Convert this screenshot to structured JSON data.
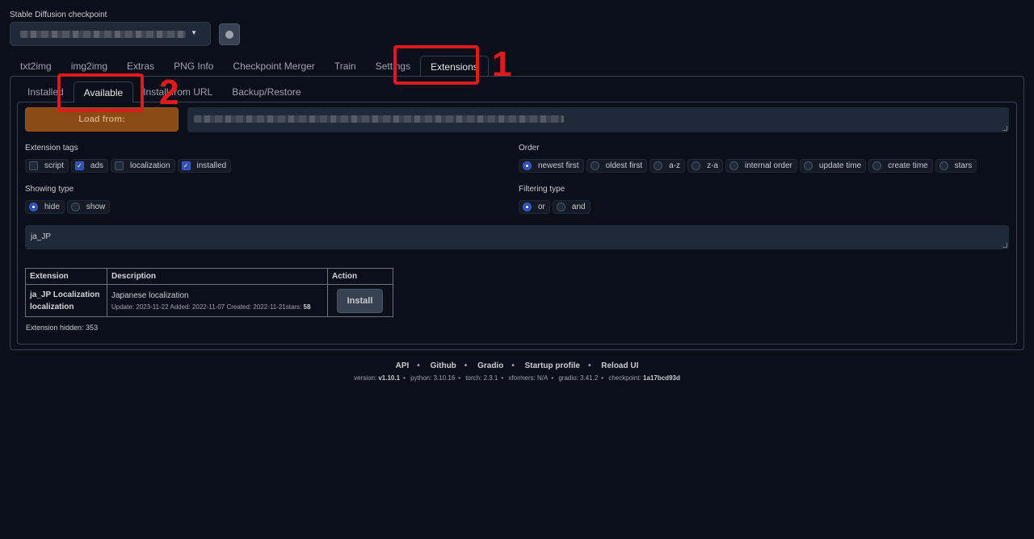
{
  "checkpoint": {
    "label": "Stable Diffusion checkpoint"
  },
  "main_tabs": [
    "txt2img",
    "img2img",
    "Extras",
    "PNG Info",
    "Checkpoint Merger",
    "Train",
    "Settings",
    "Extensions"
  ],
  "sub_tabs": [
    "Installed",
    "Available",
    "Install from URL",
    "Backup/Restore"
  ],
  "load_button": "Load from:",
  "extension_tags": {
    "label": "Extension tags",
    "options": [
      {
        "label": "script",
        "checked": false
      },
      {
        "label": "ads",
        "checked": true
      },
      {
        "label": "localization",
        "checked": false
      },
      {
        "label": "installed",
        "checked": true
      }
    ]
  },
  "order": {
    "label": "Order",
    "options": [
      "newest first",
      "oldest first",
      "a-z",
      "z-a",
      "internal order",
      "update time",
      "create time",
      "stars"
    ],
    "selected": "newest first"
  },
  "showing_type": {
    "label": "Showing type",
    "options": [
      "hide",
      "show"
    ],
    "selected": "hide"
  },
  "filtering_type": {
    "label": "Filtering type",
    "options": [
      "or",
      "and"
    ],
    "selected": "or"
  },
  "search_value": "ja_JP",
  "table": {
    "headers": [
      "Extension",
      "Description",
      "Action"
    ],
    "rows": [
      {
        "name_line1": "ja_JP Localization",
        "name_line2": "localization",
        "description": "Japanese localization",
        "meta": "Update: 2023-11-22 Added: 2022-11-07 Created: 2022-11-21stars: ",
        "stars": "58",
        "action": "Install"
      }
    ]
  },
  "hidden_count": "Extension hidden: 353",
  "footer": {
    "links": [
      "API",
      "Github",
      "Gradio",
      "Startup profile",
      "Reload UI"
    ],
    "version_items": [
      {
        "k": "version: ",
        "v": "v1.10.1",
        "bold": true
      },
      {
        "k": "python: ",
        "v": "3.10.16",
        "bold": false
      },
      {
        "k": "torch: ",
        "v": "2.3.1",
        "bold": false
      },
      {
        "k": "xformers: ",
        "v": "N/A",
        "bold": false
      },
      {
        "k": "gradio: ",
        "v": "3.41.2",
        "bold": false
      },
      {
        "k": "checkpoint: ",
        "v": "1a17bcd93d",
        "bold": true
      }
    ]
  },
  "annotations": [
    {
      "number": "1",
      "color": "#dc1c1c"
    },
    {
      "number": "2",
      "color": "#dc1c1c"
    }
  ]
}
